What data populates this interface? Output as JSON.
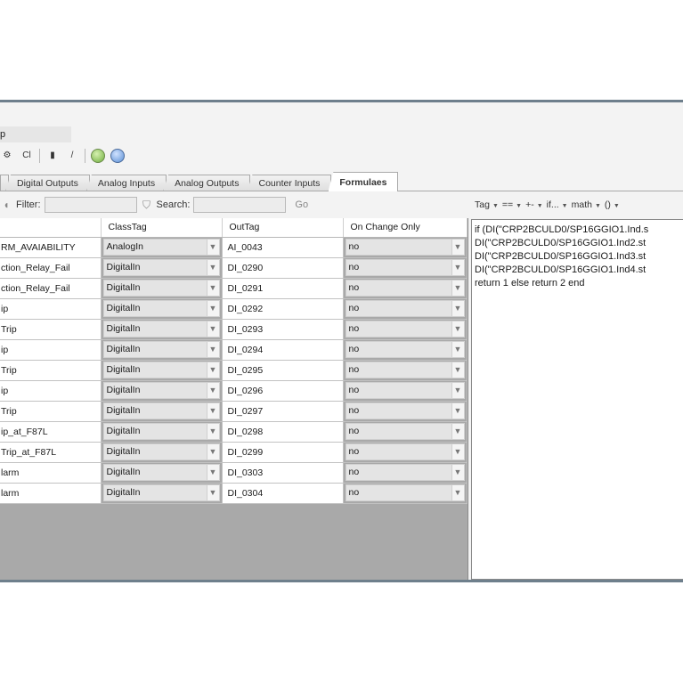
{
  "window": {
    "title_fragment": "p"
  },
  "toolbar": {
    "btn_cl": "Cl",
    "btn_italic": "/"
  },
  "tabs": [
    {
      "label": ""
    },
    {
      "label": "Digital Outputs"
    },
    {
      "label": "Analog Inputs"
    },
    {
      "label": "Analog Outputs"
    },
    {
      "label": "Counter Inputs"
    },
    {
      "label": "Formulaes",
      "active": true
    }
  ],
  "filter": {
    "label": "Filter:",
    "value": "",
    "search_label": "Search:",
    "search_value": "",
    "go_label": "Go"
  },
  "grid": {
    "headers": {
      "name": "",
      "classtag": "ClassTag",
      "outtag": "OutTag",
      "onchange": "On Change Only"
    },
    "rows": [
      {
        "name": "RM_AVAIABILITY",
        "classtag": "AnalogIn",
        "outtag": "AI_0043",
        "onchange": "no"
      },
      {
        "name": "ction_Relay_Fail",
        "classtag": "DigitalIn",
        "outtag": "DI_0290",
        "onchange": "no"
      },
      {
        "name": "ction_Relay_Fail",
        "classtag": "DigitalIn",
        "outtag": "DI_0291",
        "onchange": "no"
      },
      {
        "name": "ip",
        "classtag": "DigitalIn",
        "outtag": "DI_0292",
        "onchange": "no"
      },
      {
        "name": "Trip",
        "classtag": "DigitalIn",
        "outtag": "DI_0293",
        "onchange": "no"
      },
      {
        "name": "ip",
        "classtag": "DigitalIn",
        "outtag": "DI_0294",
        "onchange": "no"
      },
      {
        "name": "Trip",
        "classtag": "DigitalIn",
        "outtag": "DI_0295",
        "onchange": "no"
      },
      {
        "name": "ip",
        "classtag": "DigitalIn",
        "outtag": "DI_0296",
        "onchange": "no"
      },
      {
        "name": "Trip",
        "classtag": "DigitalIn",
        "outtag": "DI_0297",
        "onchange": "no"
      },
      {
        "name": "ip_at_F87L",
        "classtag": "DigitalIn",
        "outtag": "DI_0298",
        "onchange": "no"
      },
      {
        "name": "Trip_at_F87L",
        "classtag": "DigitalIn",
        "outtag": "DI_0299",
        "onchange": "no"
      },
      {
        "name": "larm",
        "classtag": "DigitalIn",
        "outtag": "DI_0303",
        "onchange": "no"
      },
      {
        "name": "larm",
        "classtag": "DigitalIn",
        "outtag": "DI_0304",
        "onchange": "no"
      }
    ]
  },
  "formula_toolbar": [
    "Tag",
    "==",
    "+-",
    "if...",
    "math",
    "()"
  ],
  "formula_lines": [
    "if (DI(\"CRP2BCULD0/SP16GGIO1.Ind.s",
    "DI(\"CRP2BCULD0/SP16GGIO1.Ind2.st",
    "DI(\"CRP2BCULD0/SP16GGIO1.Ind3.st",
    "DI(\"CRP2BCULD0/SP16GGIO1.Ind4.st",
    "return 1 else return 2 end"
  ]
}
